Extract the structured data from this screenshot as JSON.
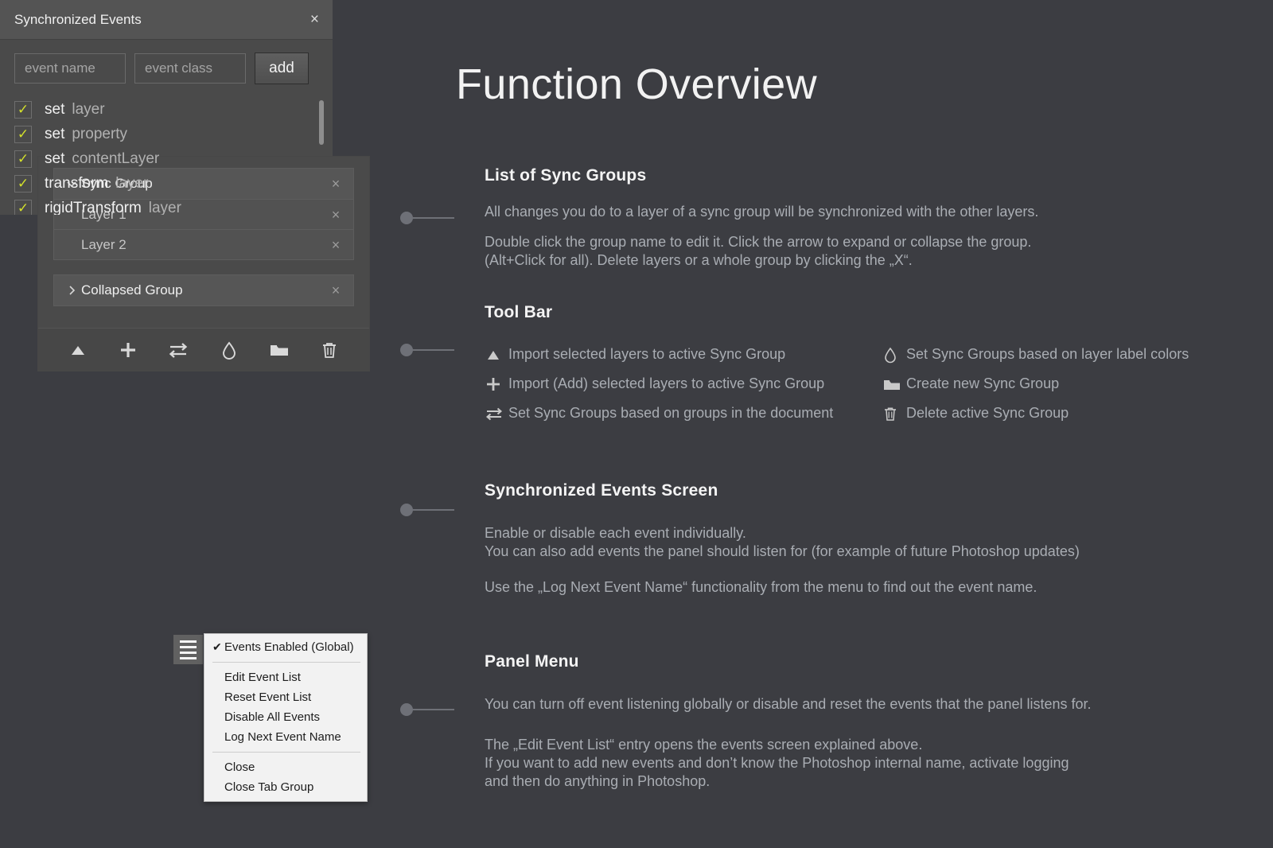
{
  "page": {
    "title": "Function Overview",
    "background_color": "#3c3d42",
    "accent_color": "#d3e02b",
    "connector_color": "#6e7077"
  },
  "sync_panel": {
    "groups": [
      {
        "name": "Sync Group",
        "caret": "chevron-down-icon",
        "close_label": "×",
        "children": [
          {
            "name": "Layer 1",
            "close_label": "×"
          },
          {
            "name": "Layer 2",
            "close_label": "×"
          }
        ]
      },
      {
        "name": "Collapsed Group",
        "caret": "chevron-right-icon",
        "close_label": "×",
        "children": []
      }
    ],
    "toolbar": [
      {
        "icon": "triangle-up-icon",
        "title": "Import selected layers to active Sync Group"
      },
      {
        "icon": "plus-icon",
        "title": "Import (Add) selected layers to active Sync Group"
      },
      {
        "icon": "swap-arrows-icon",
        "title": "Set Sync Groups based on groups in the document"
      },
      {
        "icon": "droplet-icon",
        "title": "Set Sync Groups based on layer label colors"
      },
      {
        "icon": "folder-icon",
        "title": "Create new Sync Group"
      },
      {
        "icon": "trash-icon",
        "title": "Delete active Sync Group"
      }
    ]
  },
  "events_panel": {
    "header_title": "Synchronized Events",
    "close_label": "×",
    "inputs": {
      "event_name_placeholder": "event name",
      "event_class_placeholder": "event class",
      "add_label": "add"
    },
    "checkmark": "✓",
    "items": [
      {
        "name": "set",
        "class": "layer",
        "checked": true
      },
      {
        "name": "set",
        "class": "property",
        "checked": true
      },
      {
        "name": "set",
        "class": "contentLayer",
        "checked": true
      },
      {
        "name": "transform",
        "class": "layer",
        "checked": true
      },
      {
        "name": "rigidTransform",
        "class": "layer",
        "checked": true
      }
    ]
  },
  "panel_menu": {
    "button_icon": "hamburger-icon",
    "checkmark": "✔",
    "items": [
      {
        "label": "Events Enabled (Global)",
        "checked": true
      },
      {
        "separator": true
      },
      {
        "label": "Edit Event List",
        "checked": false
      },
      {
        "label": "Reset Event List",
        "checked": false
      },
      {
        "label": "Disable All Events",
        "checked": false
      },
      {
        "label": "Log Next Event Name",
        "checked": false
      },
      {
        "separator": true
      },
      {
        "label": "Close",
        "checked": false
      },
      {
        "label": "Close Tab Group",
        "checked": false
      }
    ]
  },
  "sections": {
    "sync_groups": {
      "title": "List of Sync Groups",
      "p1": "All changes you do to a layer of a sync group will be synchronized with the other layers.",
      "p2_line1": "Double click the group name to edit it. Click the arrow to expand or collapse the group.",
      "p2_line2": "(Alt+Click for all). Delete layers or a whole group by clicking the „X“."
    },
    "tool_bar": {
      "title": "Tool Bar",
      "left_items": [
        {
          "icon": "triangle-up-icon",
          "label": "Import selected layers to active Sync Group"
        },
        {
          "icon": "plus-icon",
          "label": "Import (Add) selected layers to active Sync Group"
        },
        {
          "icon": "swap-arrows-icon",
          "label": "Set Sync Groups based on groups in the document"
        }
      ],
      "right_items": [
        {
          "icon": "droplet-icon",
          "label": "Set Sync Groups based on layer label colors"
        },
        {
          "icon": "folder-icon",
          "label": "Create new Sync Group"
        },
        {
          "icon": "trash-icon",
          "label": "Delete active Sync Group"
        }
      ]
    },
    "events_screen": {
      "title": "Synchronized Events Screen",
      "p1_line1": "Enable or disable each event individually.",
      "p1_line2": "You can also add events the panel should listen for (for example of future Photoshop updates)",
      "p2": "Use the „Log Next Event Name“ functionality from the menu to find out the event name."
    },
    "panel_menu": {
      "title": "Panel Menu",
      "p1": "You can turn off event listening globally or disable and reset the events that the panel listens for.",
      "p2_line1": "The „Edit Event List“ entry opens the events screen explained above.",
      "p2_line2": "If you want to add new events and don’t know the Photoshop internal name, activate logging",
      "p2_line3": "and then do anything in Photoshop."
    }
  }
}
